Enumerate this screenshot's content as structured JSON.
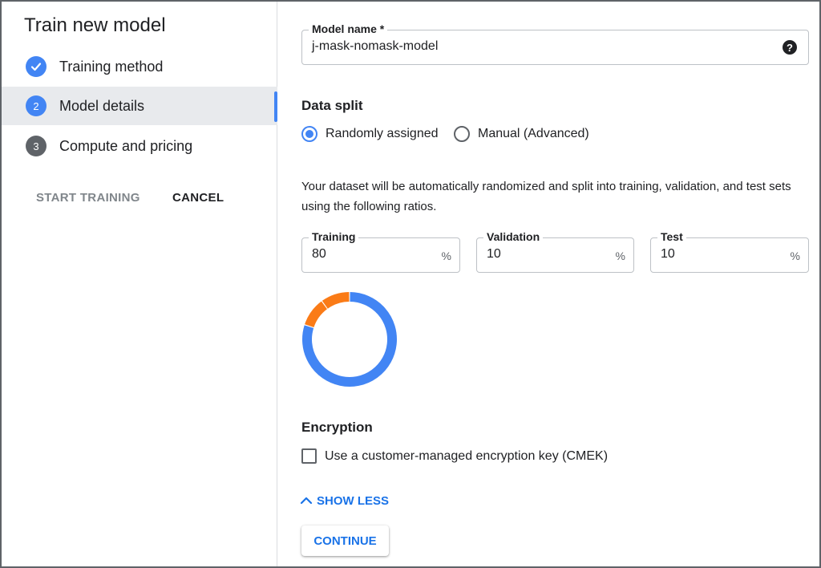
{
  "sidebar": {
    "title": "Train new model",
    "steps": [
      {
        "label": "Training method",
        "icon": "check-icon",
        "state": "done",
        "number": ""
      },
      {
        "label": "Model details",
        "icon": "step-number-icon",
        "state": "current",
        "number": "2"
      },
      {
        "label": "Compute and pricing",
        "icon": "step-number-icon",
        "state": "pending",
        "number": "3"
      }
    ],
    "start_training_label": "START TRAINING",
    "cancel_label": "CANCEL"
  },
  "model_name": {
    "label": "Model name *",
    "value": "j-mask-nomask-model",
    "help_icon": "?"
  },
  "data_split": {
    "title": "Data split",
    "options": [
      {
        "label": "Randomly assigned",
        "selected": true
      },
      {
        "label": "Manual (Advanced)",
        "selected": false
      }
    ],
    "description": "Your dataset will be automatically randomized and split into training, validation, and test sets using the following ratios.",
    "fields": [
      {
        "label": "Training",
        "value": "80",
        "suffix": "%"
      },
      {
        "label": "Validation",
        "value": "10",
        "suffix": "%"
      },
      {
        "label": "Test",
        "value": "10",
        "suffix": "%"
      }
    ]
  },
  "chart_data": {
    "type": "pie",
    "style": "donut",
    "categories": [
      "Training",
      "Validation",
      "Test"
    ],
    "values": [
      80,
      10,
      10
    ],
    "colors": [
      "#4285f4",
      "#fa7b17",
      "#fa7b17"
    ]
  },
  "encryption": {
    "title": "Encryption",
    "checkbox_label": "Use a customer-managed encryption key (CMEK)",
    "checked": false
  },
  "show_less_label": "SHOW LESS",
  "continue_label": "CONTINUE",
  "colors": {
    "accent": "#4285f4",
    "link": "#1a73e8",
    "secondary": "#fa7b17"
  }
}
